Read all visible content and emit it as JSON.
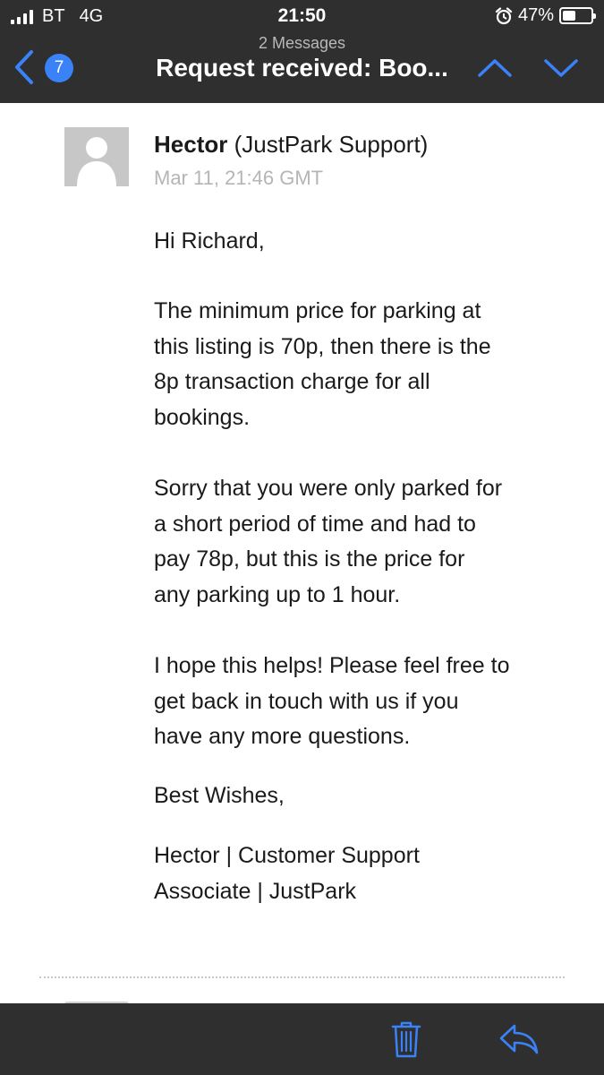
{
  "status_bar": {
    "carrier": "BT",
    "network": "4G",
    "time": "21:50",
    "battery_percent": "47%",
    "battery_level": 0.47,
    "icons": [
      "signal-bars-icon",
      "alarm-clock-icon",
      "battery-icon"
    ]
  },
  "nav": {
    "message_count": "2 Messages",
    "subject": "Request received: Boo...",
    "unread_badge": "7",
    "icons": [
      "chevron-left-icon",
      "chevron-up-icon",
      "chevron-down-icon"
    ]
  },
  "email": {
    "sender_name": "Hector",
    "sender_org": "(JustPark Support)",
    "date": "Mar 11, 21:46 GMT",
    "greeting": "Hi Richard,",
    "paragraph_1_lines": [
      "The minimum price for parking at",
      "this listing is 70p, then there is the",
      "8p transaction charge for all",
      "bookings."
    ],
    "paragraph_2_lines": [
      "Sorry that you were only parked for",
      "a short period of time and had to",
      "pay 78p, but this is the price for",
      "any parking up to 1 hour."
    ],
    "paragraph_3_lines": [
      "I hope this helps! Please feel free to",
      "get back in touch with us if you",
      "have any more questions."
    ],
    "sign_off": "Best Wishes,",
    "signature_lines": [
      "Hector | Customer Support",
      "Associate | JustPark"
    ]
  },
  "toolbar": {
    "icons": [
      "trash-icon",
      "reply-icon"
    ]
  },
  "colors": {
    "bar_background": "#2f2f2f",
    "accent_blue": "#3a82f7",
    "text_dark": "#1a1a1a",
    "text_muted": "#b5b5b5"
  }
}
